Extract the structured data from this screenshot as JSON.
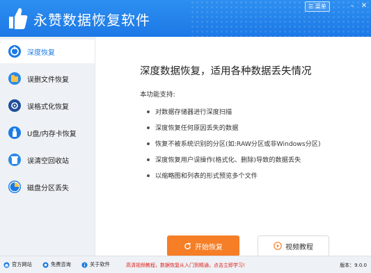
{
  "app": {
    "title": "永赞数据恢复软件",
    "menu_label": "菜单"
  },
  "sidebar": {
    "items": [
      {
        "label": "深度恢复",
        "active": true,
        "icon": "deep-recovery-icon"
      },
      {
        "label": "误删文件恢复",
        "active": false,
        "icon": "deleted-file-icon"
      },
      {
        "label": "误格式化恢复",
        "active": false,
        "icon": "format-recovery-icon"
      },
      {
        "label": "U盘/内存卡恢复",
        "active": false,
        "icon": "usb-drive-icon"
      },
      {
        "label": "误清空回收站",
        "active": false,
        "icon": "recycle-bin-icon"
      },
      {
        "label": "磁盘分区丢失",
        "active": false,
        "icon": "disk-partition-icon"
      }
    ]
  },
  "main": {
    "headline": "深度数据恢复，适用各种数据丢失情况",
    "support_label": "本功能支持:",
    "features": [
      "对数据存储器进行深度扫描",
      "深度恢复任何原因丢失的数据",
      "恢复不被系统识别的分区(如:RAW分区或非Windows分区)",
      "深度恢复用户误操作(格式化、删除)导致的数据丢失",
      "以缩略图和列表的形式预览多个文件"
    ],
    "start_button": "开始恢复",
    "video_button": "视频教程"
  },
  "statusbar": {
    "links": [
      "官方网站",
      "免费咨询",
      "关于软件"
    ],
    "promo": "高清视频教程，数据恢复从入门到精通，点击立即学习!",
    "version": "版本：9.0.0"
  },
  "colors": {
    "accent": "#1a7be6",
    "start": "#f57e26",
    "promo": "#e0201b"
  }
}
